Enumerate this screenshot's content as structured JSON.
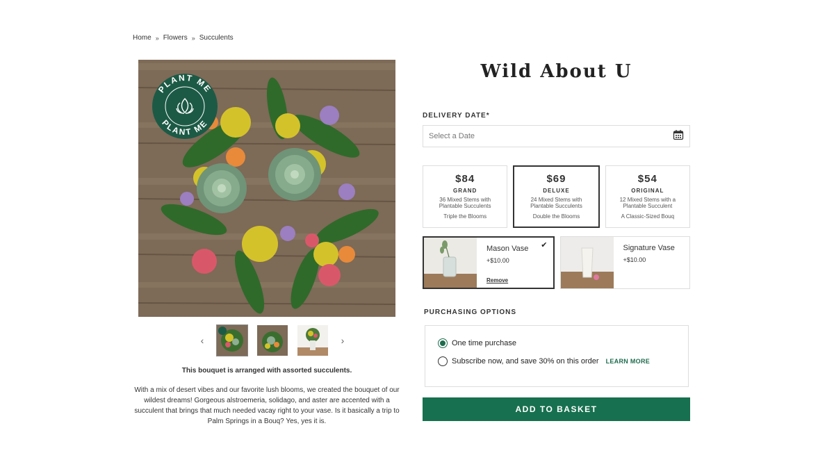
{
  "breadcrumb": [
    {
      "label": "Home"
    },
    {
      "label": "Flowers"
    },
    {
      "label": "Succulents"
    }
  ],
  "badge": {
    "text_top": "PLANT ME",
    "text_bottom": "PLANT ME",
    "icon": "lotus-icon"
  },
  "product": {
    "title": "Wild About U",
    "description_title": "This bouquet is arranged with assorted succulents.",
    "description": "With a mix of desert vibes and our favorite lush blooms, we created the bouquet of our wildest dreams! Gorgeous alstroemeria, solidago, and aster are accented with a succulent that brings that much needed vacay right to your vase. Is it basically a trip to Palm Springs in a Bouq? Yes, yes it is."
  },
  "delivery": {
    "label": "DELIVERY DATE*",
    "placeholder": "Select a Date",
    "icon": "calendar-icon"
  },
  "sizes": [
    {
      "price": "$84",
      "name": "GRAND",
      "stems": "36 Mixed Stems with Plantable Succulents",
      "tag": "Triple the Blooms",
      "selected": false
    },
    {
      "price": "$69",
      "name": "DELUXE",
      "stems": "24 Mixed Stems with Plantable Succulents",
      "tag": "Double the Blooms",
      "selected": true
    },
    {
      "price": "$54",
      "name": "ORIGINAL",
      "stems": "12 Mixed Stems with a Plantable Succulent",
      "tag": "A Classic-Sized Bouq",
      "selected": false
    }
  ],
  "vases": [
    {
      "name": "Mason Vase",
      "price": "+$10.00",
      "remove": "Remove",
      "selected": true
    },
    {
      "name": "Signature Vase",
      "price": "+$10.00",
      "selected": false
    }
  ],
  "purchasing": {
    "label": "PURCHASING OPTIONS",
    "one_time": "One time purchase",
    "subscribe": "Subscribe now, and save 30% on this order",
    "learn_more": "LEARN MORE",
    "selected": "one_time"
  },
  "cta": {
    "label": "ADD TO BASKET"
  },
  "colors": {
    "brand_green": "#17704f",
    "badge_green": "#1c5a46"
  }
}
